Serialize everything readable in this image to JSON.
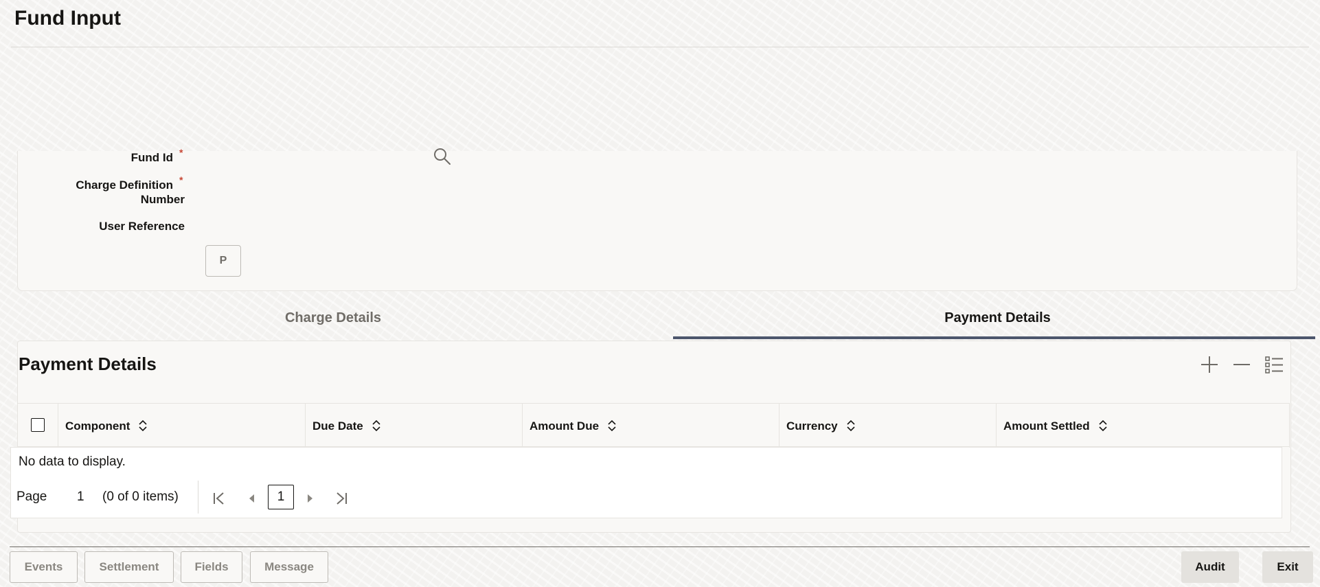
{
  "page": {
    "title": "Fund Input"
  },
  "form": {
    "fund_id_label": "Fund Id",
    "charge_def_label_line1": "Charge Definition",
    "charge_def_label_line2": "Number",
    "user_ref_label": "User Reference",
    "required_mark": "*",
    "p_button_label": "P"
  },
  "tabs": [
    {
      "label": "Charge Details",
      "active": false
    },
    {
      "label": "Payment Details",
      "active": true
    }
  ],
  "grid": {
    "title": "Payment Details",
    "columns": [
      "Component",
      "Due Date",
      "Amount Due",
      "Currency",
      "Amount Settled"
    ],
    "empty_text": "No data to display.",
    "pager": {
      "page_label": "Page",
      "page_number": "1",
      "items_text": "(0 of 0 items)",
      "current_page": "1"
    }
  },
  "footer": {
    "buttons": [
      "Events",
      "Settlement",
      "Fields",
      "Message"
    ],
    "audit_label": "Audit",
    "exit_label": "Exit"
  },
  "colors": {
    "required": "#c74634",
    "tab_underline": "#4c566c",
    "text": "#161513",
    "muted": "#6f6c67"
  },
  "icons": [
    "search-icon",
    "add-icon",
    "remove-icon",
    "column-list-icon",
    "sort-icon",
    "first-page-icon",
    "prev-page-icon",
    "next-page-icon",
    "last-page-icon"
  ]
}
